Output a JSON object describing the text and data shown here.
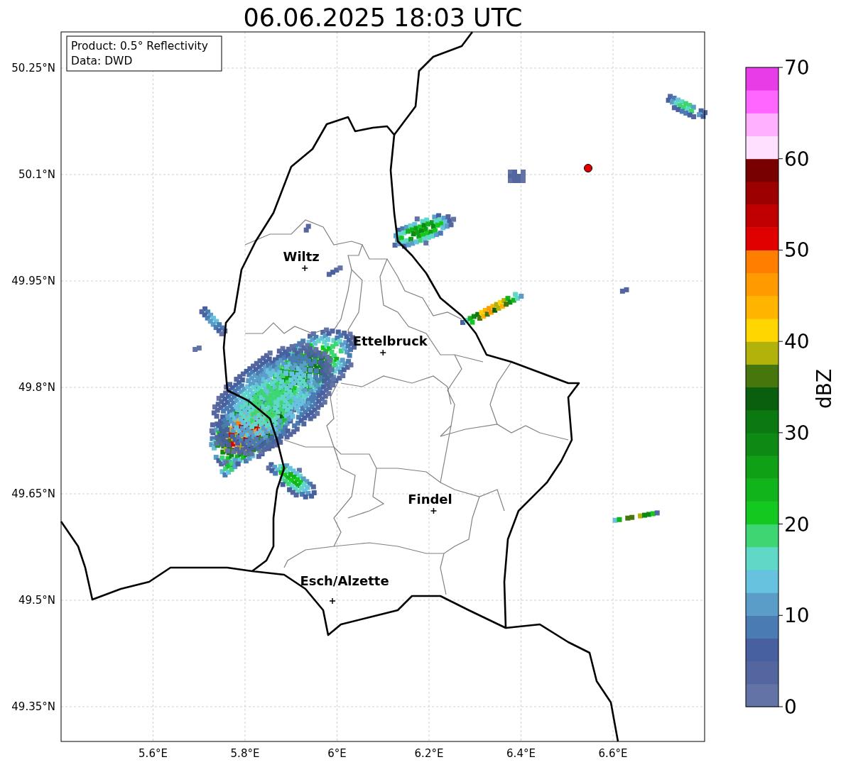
{
  "title": "06.06.2025 18:03 UTC",
  "info_box": {
    "lines": [
      "Product: 0.5° Reflectivity",
      "Data: DWD"
    ]
  },
  "map": {
    "lat_labels": [
      "50.25°N",
      "50.1°N",
      "49.95°N",
      "49.8°N",
      "49.65°N",
      "49.5°N",
      "49.35°N"
    ],
    "lon_labels": [
      "5.6°E",
      "5.8°E",
      "6°E",
      "6.2°E",
      "6.4°E",
      "6.6°E"
    ],
    "cities": [
      {
        "name": "Wiltz"
      },
      {
        "name": "Ettelbruck"
      },
      {
        "name": "Findel"
      },
      {
        "name": "Esch/Alzette"
      }
    ]
  },
  "colorbar": {
    "label": "dBZ",
    "ticks": [
      "70",
      "60",
      "50",
      "40",
      "30",
      "20",
      "10",
      "0"
    ],
    "bins": [
      {
        "color": "#6373a6"
      },
      {
        "color": "#54669f"
      },
      {
        "color": "#4660a0"
      },
      {
        "color": "#4a7bb2"
      },
      {
        "color": "#5a9dc8"
      },
      {
        "color": "#66c2de"
      },
      {
        "color": "#5fd8c8"
      },
      {
        "color": "#3dd673"
      },
      {
        "color": "#13c81f"
      },
      {
        "color": "#12b41b"
      },
      {
        "color": "#10a015"
      },
      {
        "color": "#0e8a14"
      },
      {
        "color": "#0b7812"
      },
      {
        "color": "#0a5f0e"
      },
      {
        "color": "#47770c"
      },
      {
        "color": "#b1b30a"
      },
      {
        "color": "#ffd600"
      },
      {
        "color": "#ffb500"
      },
      {
        "color": "#ff9b00"
      },
      {
        "color": "#ff7e00"
      },
      {
        "color": "#e00000"
      },
      {
        "color": "#c00000"
      },
      {
        "color": "#9c0000"
      },
      {
        "color": "#780000"
      },
      {
        "color": "#ffe0ff"
      },
      {
        "color": "#ffb0ff"
      },
      {
        "color": "#ff66ff"
      },
      {
        "color": "#e83ce8"
      }
    ]
  }
}
